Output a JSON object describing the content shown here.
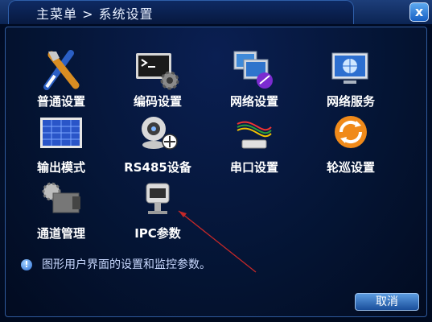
{
  "window": {
    "title": "主菜单 > 系统设置",
    "close_glyph": "x"
  },
  "menu": {
    "items": [
      {
        "label": "普通设置",
        "icon": "tools-icon"
      },
      {
        "label": "编码设置",
        "icon": "terminal-gear-icon"
      },
      {
        "label": "网络设置",
        "icon": "network-monitors-icon"
      },
      {
        "label": "网络服务",
        "icon": "globe-monitor-icon"
      },
      {
        "label": "输出模式",
        "icon": "grid-display-icon"
      },
      {
        "label": "RS485设备",
        "icon": "ptz-camera-icon"
      },
      {
        "label": "串口设置",
        "icon": "serial-cable-icon"
      },
      {
        "label": "轮巡设置",
        "icon": "refresh-cycle-icon"
      },
      {
        "label": "通道管理",
        "icon": "camera-gear-icon"
      },
      {
        "label": "IPC参数",
        "icon": "ip-camera-icon"
      }
    ]
  },
  "info": {
    "text": "图形用户界面的设置和监控参数。"
  },
  "buttons": {
    "cancel": "取消"
  },
  "colors": {
    "background": "#031230",
    "accent": "#2f5a9c",
    "text": "#ffffff"
  }
}
